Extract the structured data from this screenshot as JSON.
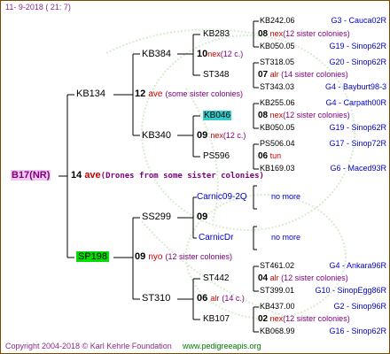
{
  "header": "11-  9-2018  ( 21:  7)",
  "footer": {
    "copyright": "Copyright 2004-2018 © Karl Kehrle Foundation",
    "website": "www.pedigreeapis.org"
  },
  "root": {
    "name": "B17(NR)"
  },
  "gen1": {
    "number": "14",
    "code": "ave",
    "note": "(Drones from some sister colonies)"
  },
  "father": {
    "name": "KB134",
    "number": "12",
    "code": "ave",
    "note": "(some sister colonies)"
  },
  "mother": {
    "name": "SP198",
    "number": "09",
    "code": "nyo",
    "note": "(12 sister colonies)"
  },
  "ff": {
    "name": "KB384",
    "number": "10",
    "code": "nex",
    "note": "(12 c.)"
  },
  "fm": {
    "name": "KB340",
    "number": "09",
    "code": "nex",
    "note": "(12 c.)"
  },
  "mf": {
    "name": "SS299",
    "number": "09"
  },
  "mm": {
    "name": "ST310",
    "number": "06",
    "code": "alr",
    "note": "(14 c.)"
  },
  "fff": {
    "name": "KB283",
    "number": "08",
    "code": "nex",
    "note": "(12 sister colonies)"
  },
  "ffm": {
    "name": "ST348",
    "number": "07",
    "code": "alr",
    "note": "(14 sister colonies)"
  },
  "fmf": {
    "name": "KB046",
    "number": "08",
    "code": "nex",
    "note": "(12 sister colonies)"
  },
  "fmm": {
    "name": "PS596",
    "number": "06",
    "code": "tun"
  },
  "mff": {
    "name": "Carnic09-2Q",
    "more": "no more"
  },
  "mfm": {
    "name": "CarnicDr",
    "more": "no more"
  },
  "mmf": {
    "name": "ST442",
    "number": "04",
    "code": "alr",
    "note": "(12 sister colonies)"
  },
  "mmm": {
    "name": "KB107",
    "number": "02",
    "code": "nex",
    "note": "(12 sister colonies)"
  },
  "leaves": [
    {
      "name": "KB242.06",
      "id": "G3 - Cauca02R"
    },
    {
      "name": "KB050.05",
      "id": "G19 - Sinop62R"
    },
    {
      "name": "ST318.05",
      "id": "G20 - Sinop62R"
    },
    {
      "name": "ST343.03",
      "id": "G4 - Bayburt98-3"
    },
    {
      "name": "KB255.06",
      "id": "G4 - Carpath00R"
    },
    {
      "name": "KB050.05",
      "id": "G19 - Sinop62R"
    },
    {
      "name": "PS506.04",
      "id": "G17 - Sinop72R"
    },
    {
      "name": "KB169.03",
      "id": "G6 - Maced93R"
    },
    {
      "name": "ST461.02",
      "id": "G4 - Ankara96R"
    },
    {
      "name": "ST399.01",
      "id": "G10 - SinopEgg86R"
    },
    {
      "name": "KB437.00",
      "id": "G2 - Sinop96R"
    },
    {
      "name": "KB068.99",
      "id": "G16 - Sinop62R"
    }
  ]
}
